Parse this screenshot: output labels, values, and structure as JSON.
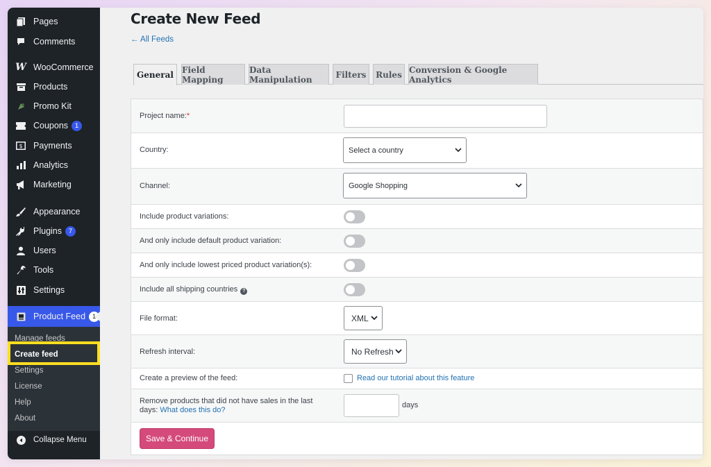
{
  "sidebar": {
    "items": [
      {
        "label": "Pages",
        "icon": "pages-icon"
      },
      {
        "label": "Comments",
        "icon": "comments-icon"
      },
      {
        "label": "WooCommerce",
        "icon": "woocommerce-icon"
      },
      {
        "label": "Products",
        "icon": "products-icon"
      },
      {
        "label": "Promo Kit",
        "icon": "promo-kit-icon"
      },
      {
        "label": "Coupons",
        "icon": "coupons-icon",
        "badge": "1"
      },
      {
        "label": "Payments",
        "icon": "payments-icon"
      },
      {
        "label": "Analytics",
        "icon": "analytics-icon"
      },
      {
        "label": "Marketing",
        "icon": "marketing-icon"
      },
      {
        "label": "Appearance",
        "icon": "appearance-icon"
      },
      {
        "label": "Plugins",
        "icon": "plugins-icon",
        "badge": "7"
      },
      {
        "label": "Users",
        "icon": "users-icon"
      },
      {
        "label": "Tools",
        "icon": "tools-icon"
      },
      {
        "label": "Settings",
        "icon": "settings-icon"
      }
    ],
    "active_item": {
      "label": "Product Feed",
      "badge": "1",
      "icon": "product-feed-icon"
    },
    "submenu": [
      "Manage feeds",
      "Create feed",
      "Settings",
      "License",
      "Help",
      "About"
    ],
    "collapse_label": "Collapse Menu"
  },
  "header": {
    "title": "Create New Feed",
    "back_link": "← All Feeds"
  },
  "tabs": [
    "General",
    "Field Mapping",
    "Data Manipulation",
    "Filters",
    "Rules",
    "Conversion & Google Analytics"
  ],
  "form": {
    "project_name_label": "Project name:",
    "required_mark": "*",
    "country_label": "Country:",
    "country_value": "Select a country",
    "channel_label": "Channel:",
    "channel_value": "Google Shopping",
    "variations_label": "Include product variations:",
    "default_variation_label": "And only include default product variation:",
    "lowest_variation_label": "And only include lowest priced product variation(s):",
    "shipping_label": "Include all shipping countries",
    "file_format_label": "File format:",
    "file_format_value": "XML",
    "refresh_label": "Refresh interval:",
    "refresh_value": "No Refresh",
    "preview_label": "Create a preview of the feed:",
    "preview_link": "Read our tutorial about this feature",
    "remove_label_line1": "Remove products that did not have sales in the last",
    "remove_label_line2_prefix": "days:",
    "remove_label_link": "What does this do?",
    "days_unit": "days",
    "save_button": "Save & Continue"
  },
  "colors": {
    "sidebar_bg": "#1d2327",
    "active_blue": "#3858e9",
    "highlight_yellow": "#ffde21",
    "save_pink": "#d44a7a",
    "link_blue": "#2271b1"
  }
}
